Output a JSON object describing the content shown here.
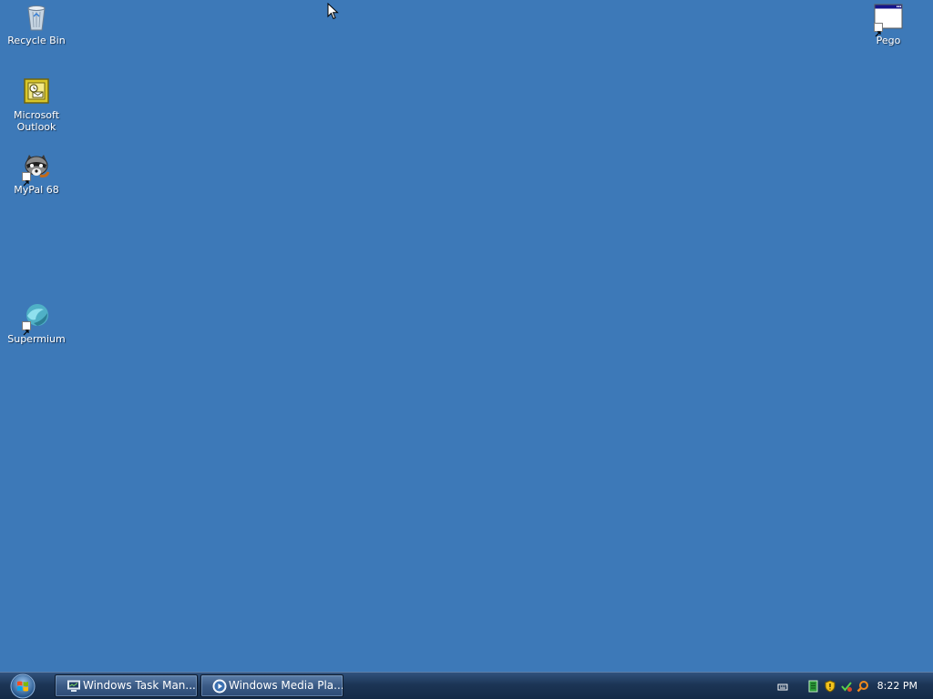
{
  "desktop": {
    "icons": [
      {
        "name": "recycle-bin",
        "label": "Recycle Bin",
        "icon": "recycle-bin-icon"
      },
      {
        "name": "microsoft-outlook",
        "label": "Microsoft\nOutlook",
        "icon": "outlook-icon"
      },
      {
        "name": "mypal-68",
        "label": "MyPal 68",
        "icon": "raccoon-icon"
      },
      {
        "name": "supermium",
        "label": "Supermium",
        "icon": "supermium-icon"
      },
      {
        "name": "pego",
        "label": "Pego",
        "icon": "window-icon"
      }
    ]
  },
  "taskbar": {
    "start_icon": "windows-logo-icon",
    "tasks": [
      {
        "label": "Windows Task Man...",
        "icon": "task-manager-icon"
      },
      {
        "label": "Windows Media Pla...",
        "icon": "media-player-icon"
      }
    ],
    "tray": {
      "icons": [
        "keyboard-icon",
        "network-icon",
        "shield-icon",
        "security-icon",
        "search-icon"
      ],
      "clock": "8:22 PM"
    }
  },
  "colors": {
    "desktop_background": "#3d79b8",
    "taskbar": "#1c3555"
  }
}
